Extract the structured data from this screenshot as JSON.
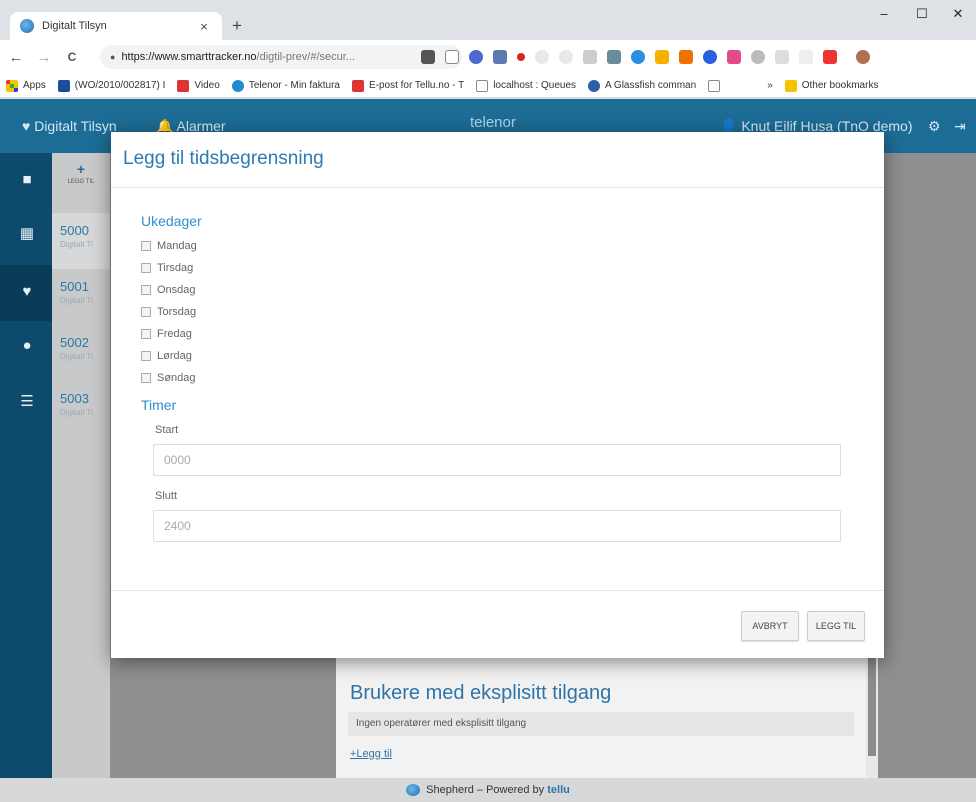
{
  "browser": {
    "tab_title": "Digitalt Tilsyn",
    "tab_close": "×",
    "new_tab": "+",
    "win_min": "–",
    "win_max": "☐",
    "win_close": "✕",
    "back": "←",
    "forward": "→",
    "reload": "C",
    "url_host": "https://www.smarttracker.no",
    "url_path": "/digtil-prev/#/secur...",
    "bookmarks": [
      "Apps",
      "(WO/2010/002817) I",
      "Video",
      "Telenor - Min faktura",
      "E-post for Tellu.no - T",
      "localhost : Queues",
      "A Glassfish comman",
      "»",
      "Other bookmarks"
    ]
  },
  "app": {
    "brand": "♥ Digitalt Tilsyn",
    "alarms": "🔔 Alarmer",
    "logo": "telenor",
    "user": "👤 Knut Eilif Husa (TnO demo)",
    "add_label": "+",
    "add_sub": "LEGG TIL",
    "list": [
      {
        "num": "5000",
        "sub": "Digitalt Ti"
      },
      {
        "num": "5001",
        "sub": "Digitalt Ti"
      },
      {
        "num": "5002",
        "sub": "Digitalt Ti"
      },
      {
        "num": "5003",
        "sub": "Digitalt Ti"
      }
    ],
    "explicit_access_title": "Brukere med eksplisitt tilgang",
    "explicit_access_empty": "Ingen operatører med eksplisitt tilgang",
    "explicit_access_add": "+Legg til",
    "footer_text": "Shepherd – Powered by",
    "footer_brand": "tellu"
  },
  "modal": {
    "title": "Legg til tidsbegrensning",
    "weekdays_title": "Ukedager",
    "weekdays": [
      "Mandag",
      "Tirsdag",
      "Onsdag",
      "Torsdag",
      "Fredag",
      "Lørdag",
      "Søndag"
    ],
    "hours_title": "Timer",
    "start_label": "Start",
    "start_placeholder": "0000",
    "end_label": "Slutt",
    "end_placeholder": "2400",
    "cancel_label": "AVBRYT",
    "add_label": "LEGG TIL"
  },
  "colors": {
    "appbar": "#1d6c95",
    "sidebar": "#0e4a6c",
    "accent": "#2d8fce"
  }
}
